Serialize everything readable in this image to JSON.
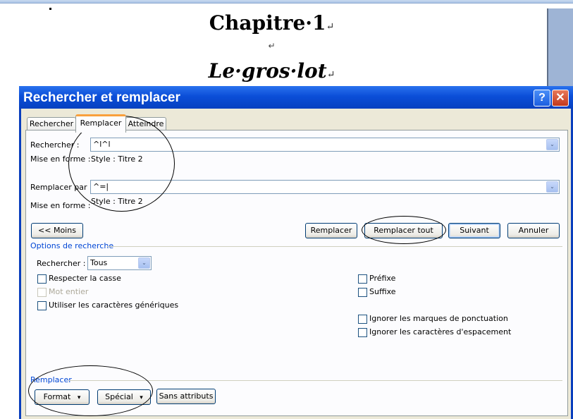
{
  "document": {
    "title": "Chapitre·1",
    "title_mark": "↵",
    "empty_para_mark": "↵",
    "subtitle": "Le·gros·lot",
    "subtitle_mark": "↵"
  },
  "dialog": {
    "title": "Rechercher et remplacer",
    "help_label": "?",
    "close_label": "✕",
    "tabs": [
      {
        "label": "Rechercher",
        "active": false
      },
      {
        "label": "Remplacer",
        "active": true
      },
      {
        "label": "Atteindre",
        "active": false
      }
    ],
    "find": {
      "label": "Rechercher :",
      "value": "^l^l",
      "format_label": "Mise en forme :",
      "format_value": "Style : Titre 2"
    },
    "replace": {
      "label": "Remplacer par :",
      "value": "^=|",
      "format_label": "Mise en forme :",
      "format_value": "Style : Titre 2"
    },
    "buttons": {
      "less": "<< Moins",
      "replace": "Remplacer",
      "replace_all": "Remplacer tout",
      "next": "Suivant",
      "cancel": "Annuler"
    },
    "search_options": {
      "title": "Options de recherche",
      "search_label": "Rechercher :",
      "search_value": "Tous",
      "left": [
        {
          "label": "Respecter la casse",
          "checked": false,
          "disabled": false
        },
        {
          "label": "Mot entier",
          "checked": false,
          "disabled": true
        },
        {
          "label": "Utiliser les caractères génériques",
          "checked": false,
          "disabled": false
        }
      ],
      "right_top": [
        {
          "label": "Préfixe",
          "checked": false
        },
        {
          "label": "Suffixe",
          "checked": false
        }
      ],
      "right_bottom": [
        {
          "label": "Ignorer les marques de ponctuation",
          "checked": false
        },
        {
          "label": "Ignorer les caractères d'espacement",
          "checked": false
        }
      ]
    },
    "replace_group": {
      "title": "Remplacer",
      "format_button": "Format",
      "special_button": "Spécial",
      "no_attributes_button": "Sans attributs",
      "dropdown_glyph": "▾"
    },
    "combo_arrow": "⌄"
  }
}
